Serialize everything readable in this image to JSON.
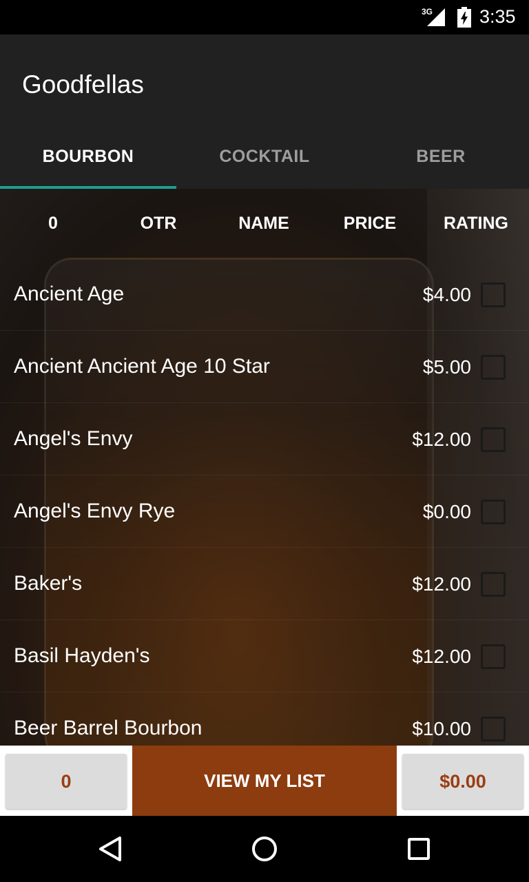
{
  "status_bar": {
    "network": "3G",
    "time": "3:35",
    "icons": [
      "signal-icon",
      "battery-icon"
    ]
  },
  "app_bar": {
    "title": "Goodfellas"
  },
  "tabs": [
    {
      "label": "BOURBON",
      "active": true
    },
    {
      "label": "COCKTAIL",
      "active": false
    },
    {
      "label": "BEER",
      "active": false
    }
  ],
  "columns": [
    {
      "label": "0"
    },
    {
      "label": "OTR"
    },
    {
      "label": "NAME"
    },
    {
      "label": "PRICE"
    },
    {
      "label": "RATING"
    }
  ],
  "items": [
    {
      "name": "Ancient Age",
      "price": "$4.00",
      "checked": false
    },
    {
      "name": "Ancient Ancient Age 10 Star",
      "price": "$5.00",
      "checked": false
    },
    {
      "name": "Angel's Envy",
      "price": "$12.00",
      "checked": false
    },
    {
      "name": "Angel's Envy Rye",
      "price": "$0.00",
      "checked": false
    },
    {
      "name": "Baker's",
      "price": "$12.00",
      "checked": false
    },
    {
      "name": "Basil Hayden's",
      "price": "$12.00",
      "checked": false
    },
    {
      "name": "Beer Barrel Bourbon",
      "price": "$10.00",
      "checked": false
    }
  ],
  "action_bar": {
    "count": "0",
    "view_list_label": "VIEW MY LIST",
    "total": "$0.00"
  },
  "nav_bar": {
    "icons": [
      "back-icon",
      "home-icon",
      "recents-icon"
    ]
  },
  "colors": {
    "tab_indicator": "#1e9e8f",
    "accent": "#8d3c10",
    "accent_text": "#9b3d12",
    "app_bar": "#212121"
  }
}
